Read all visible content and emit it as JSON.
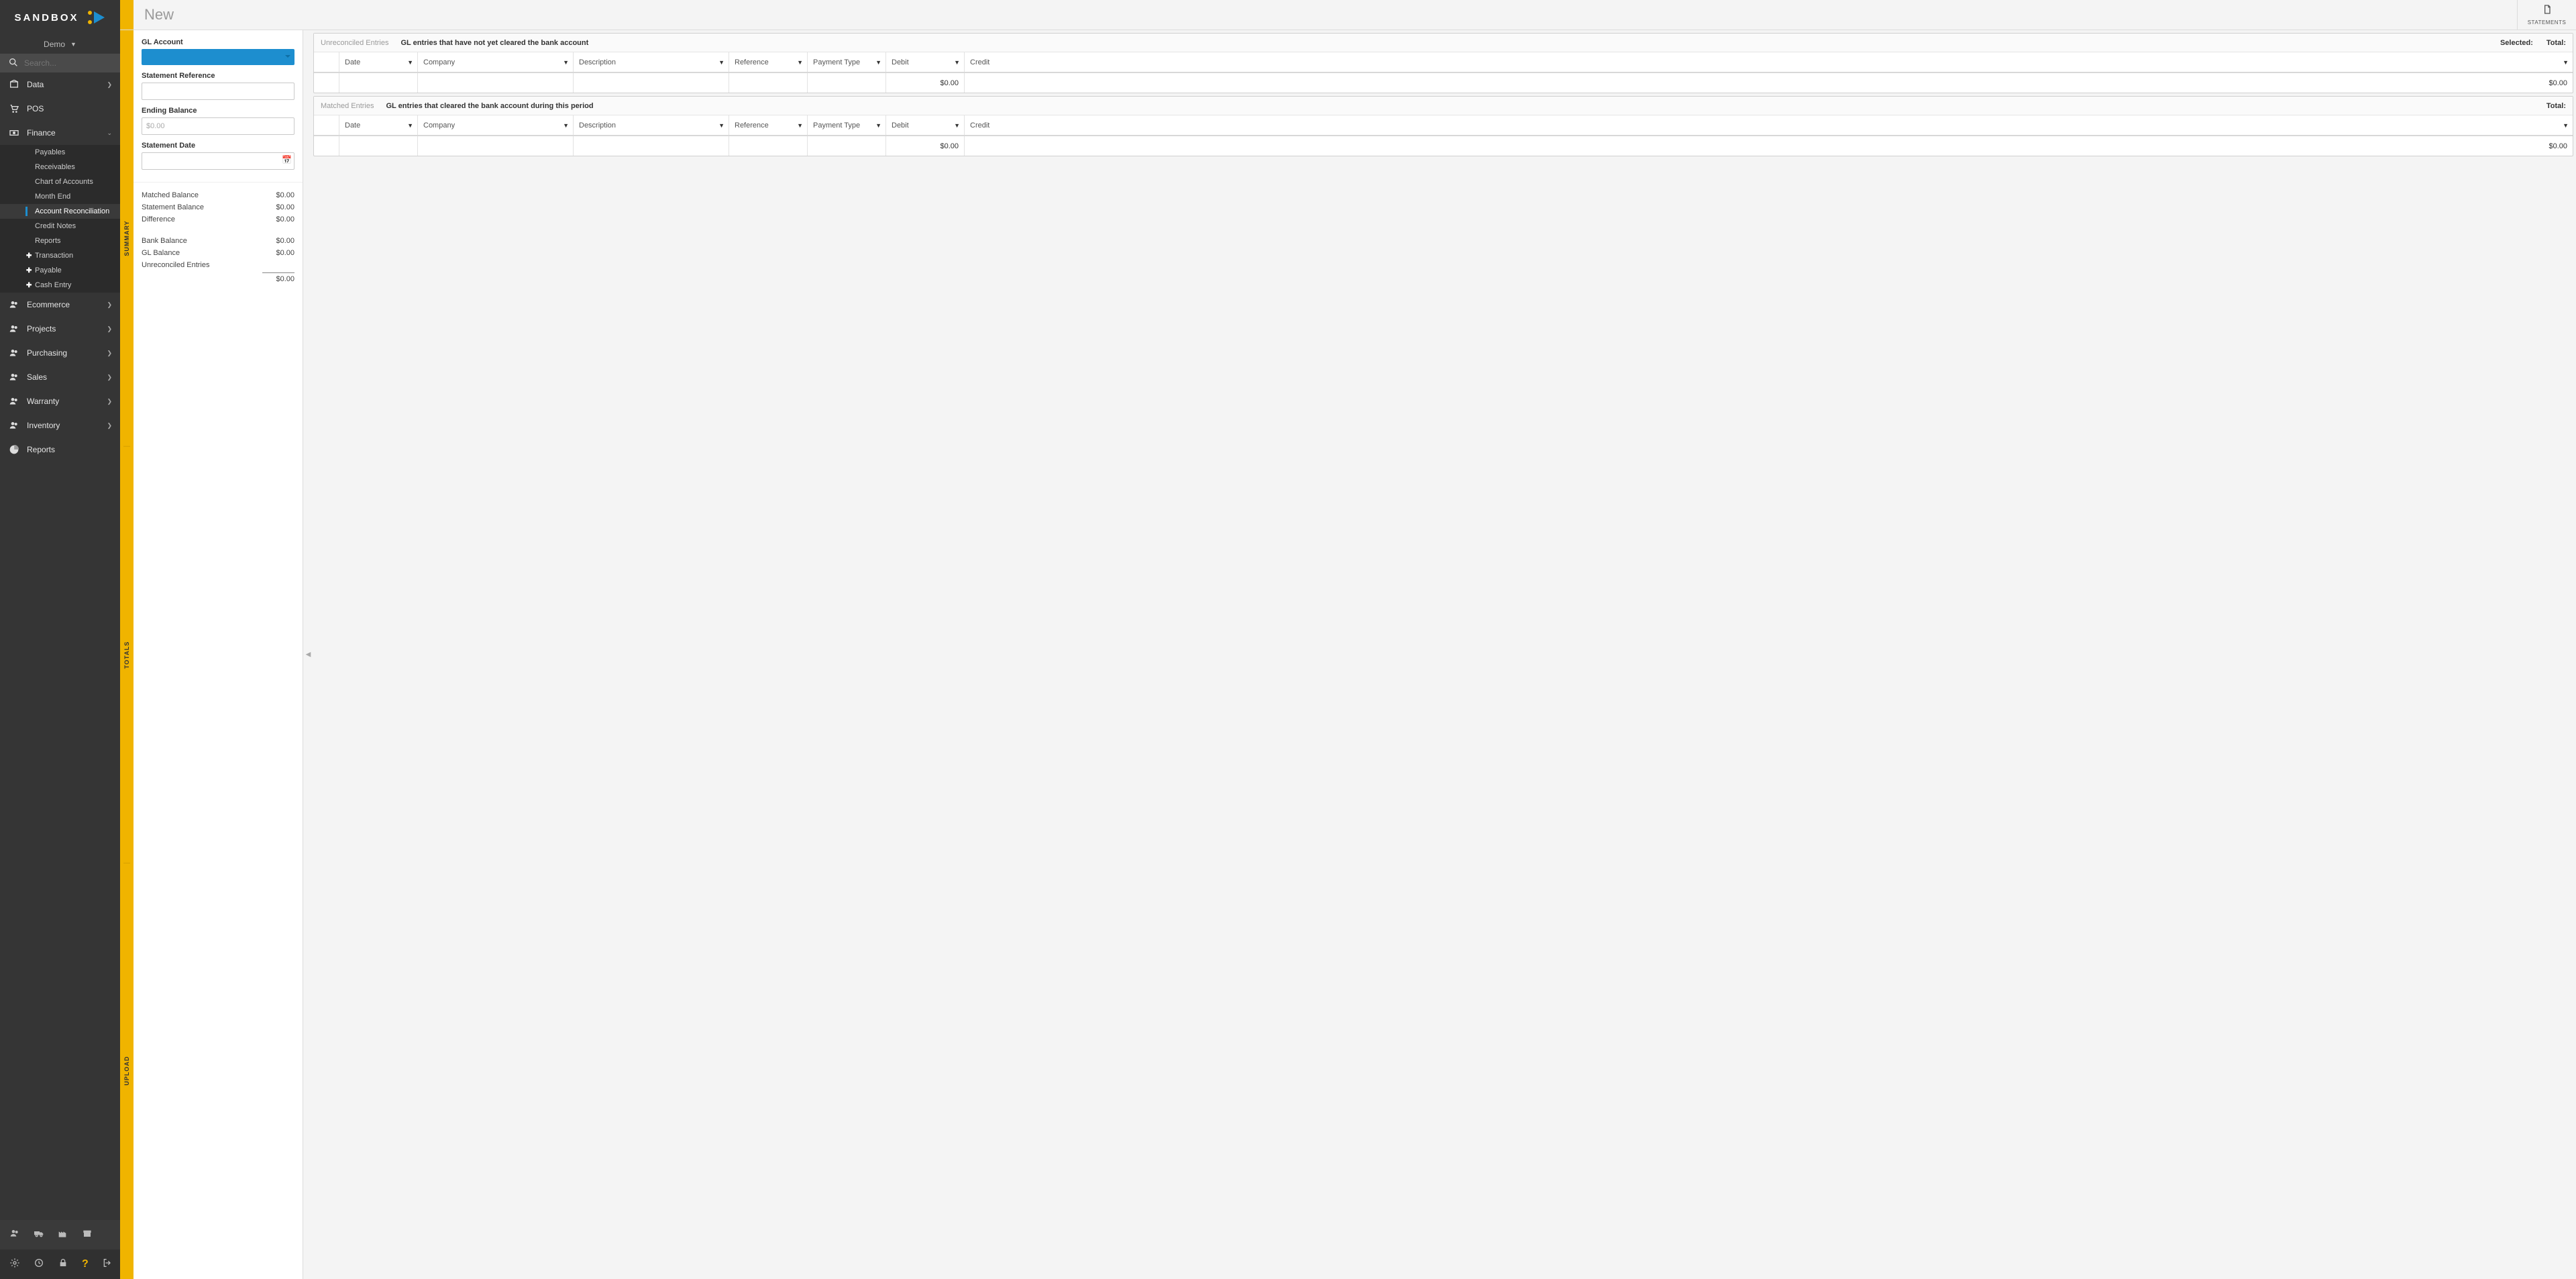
{
  "brand": "SANDBOX",
  "org": "Demo",
  "search_placeholder": "Search...",
  "nav": {
    "data": "Data",
    "pos": "POS",
    "finance": "Finance",
    "finance_sub": {
      "payables": "Payables",
      "receivables": "Receivables",
      "coa": "Chart of Accounts",
      "month_end": "Month End",
      "acct_recon": "Account Reconciliation",
      "credit_notes": "Credit Notes",
      "reports": "Reports",
      "transaction": "Transaction",
      "payable": "Payable",
      "cash_entry": "Cash Entry"
    },
    "ecommerce": "Ecommerce",
    "projects": "Projects",
    "purchasing": "Purchasing",
    "sales": "Sales",
    "warranty": "Warranty",
    "inventory": "Inventory",
    "reports": "Reports"
  },
  "page_title": "New",
  "toolbar": {
    "statements": "STATEMENTS"
  },
  "vtabs": {
    "summary": "SUMMARY",
    "totals": "TOTALS",
    "upload": "UPLOAD"
  },
  "form": {
    "gl_account_label": "GL Account",
    "stmt_ref_label": "Statement Reference",
    "ending_bal_label": "Ending Balance",
    "ending_bal_placeholder": "$0.00",
    "stmt_date_label": "Statement Date"
  },
  "totals": {
    "matched_balance_label": "Matched Balance",
    "matched_balance_value": "$0.00",
    "stmt_balance_label": "Statement Balance",
    "stmt_balance_value": "$0.00",
    "difference_label": "Difference",
    "difference_value": "$0.00",
    "bank_balance_label": "Bank Balance",
    "bank_balance_value": "$0.00",
    "gl_balance_label": "GL Balance",
    "gl_balance_value": "$0.00",
    "unrec_label": "Unreconciled Entries",
    "unrec_value": "$0.00"
  },
  "grids": {
    "columns": {
      "date": "Date",
      "company": "Company",
      "description": "Description",
      "reference": "Reference",
      "payment_type": "Payment Type",
      "debit": "Debit",
      "credit": "Credit"
    },
    "unreconciled": {
      "label": "Unreconciled Entries",
      "desc": "GL entries that have not yet cleared the bank account",
      "selected_label": "Selected:",
      "total_label": "Total:",
      "footer_debit": "$0.00",
      "footer_credit": "$0.00"
    },
    "matched": {
      "label": "Matched Entries",
      "desc": "GL entries that cleared the bank account during this period",
      "total_label": "Total:",
      "footer_debit": "$0.00",
      "footer_credit": "$0.00"
    }
  }
}
